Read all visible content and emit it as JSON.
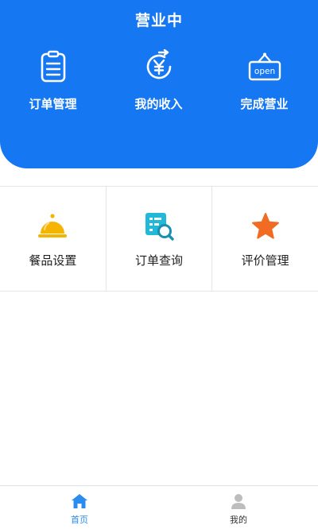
{
  "header": {
    "status_title": "营业中",
    "actions": [
      {
        "label": "订单管理",
        "icon": "clipboard-icon"
      },
      {
        "label": "我的收入",
        "icon": "yuan-income-icon"
      },
      {
        "label": "完成营业",
        "icon": "open-sign-icon",
        "sign_text": "open"
      }
    ],
    "color": "#1677f2"
  },
  "grid": {
    "items": [
      {
        "label": "餐品设置",
        "icon": "food-cloche-icon",
        "color": "#f5b400"
      },
      {
        "label": "订单查询",
        "icon": "order-search-icon",
        "color": "#22b8d8"
      },
      {
        "label": "评价管理",
        "icon": "star-icon",
        "color": "#f26b22"
      }
    ]
  },
  "bottom_nav": {
    "items": [
      {
        "label": "首页",
        "icon": "home-icon",
        "active": true
      },
      {
        "label": "我的",
        "icon": "user-icon",
        "active": false
      }
    ]
  }
}
